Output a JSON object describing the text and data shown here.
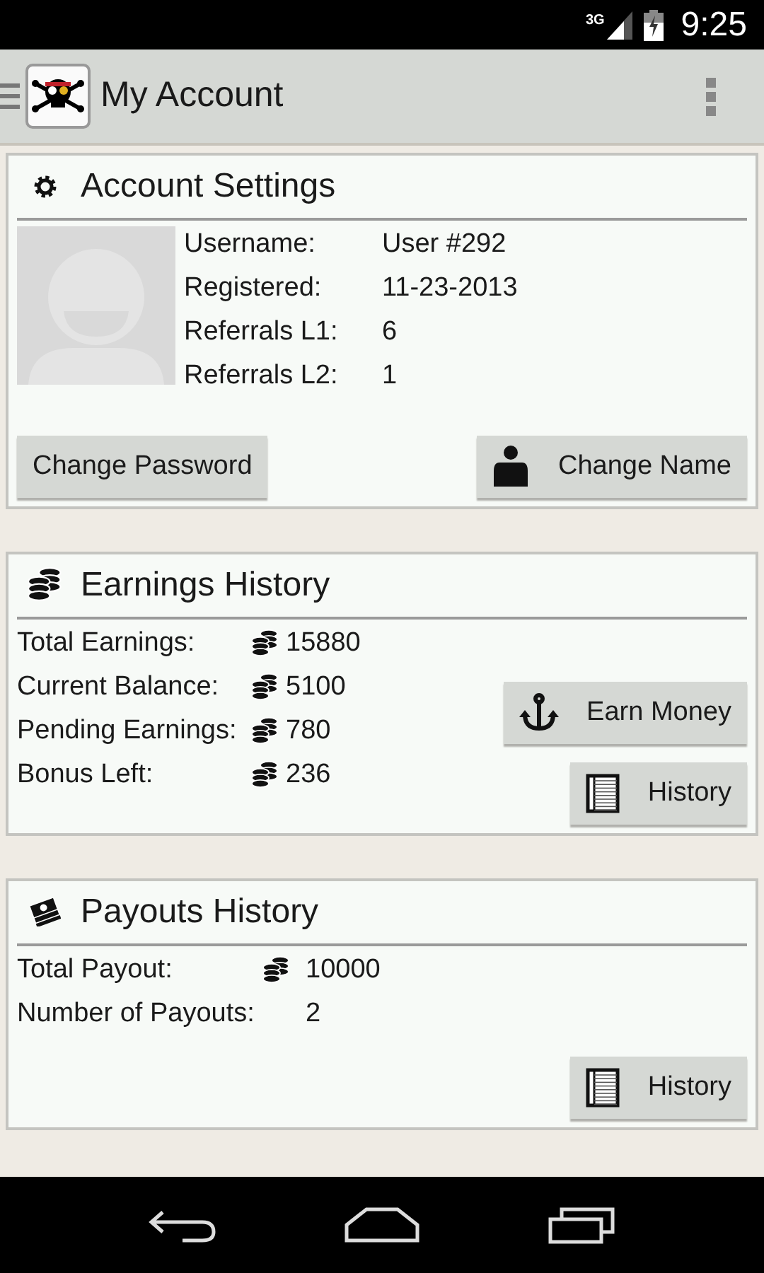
{
  "status_bar": {
    "network": "3G",
    "time": "9:25"
  },
  "action_bar": {
    "title": "My Account"
  },
  "account_settings": {
    "title": "Account Settings",
    "fields": [
      {
        "label": "Username:",
        "value": "User #292"
      },
      {
        "label": "Registered:",
        "value": "11-23-2013"
      },
      {
        "label": "Referrals L1:",
        "value": "6"
      },
      {
        "label": "Referrals L2:",
        "value": "1"
      }
    ],
    "buttons": [
      {
        "label": "Change Password",
        "kind": "plain"
      },
      {
        "label": "Change Name",
        "kind": "person"
      }
    ]
  },
  "earnings_history": {
    "title": "Earnings History",
    "rows": [
      {
        "label": "Total Earnings:",
        "value": "15880",
        "kind": "coins"
      },
      {
        "label": "Current Balance:",
        "value": "5100",
        "kind": "coins"
      },
      {
        "label": "Pending Earnings:",
        "value": "780",
        "kind": "coins"
      },
      {
        "label": "Bonus Left:",
        "value": "236",
        "kind": "coins"
      }
    ],
    "buttons": [
      {
        "label": "Earn Money",
        "kind": "anchor"
      },
      {
        "label": "History",
        "kind": "ledger"
      }
    ]
  },
  "payouts_history": {
    "title": "Payouts History",
    "rows": [
      {
        "label": "Total Payout:",
        "value": "10000",
        "kind": "coins"
      },
      {
        "label": "Number of Payouts:",
        "value": "2",
        "kind": "plain"
      }
    ],
    "buttons": [
      {
        "label": "History",
        "kind": "ledger"
      }
    ]
  }
}
